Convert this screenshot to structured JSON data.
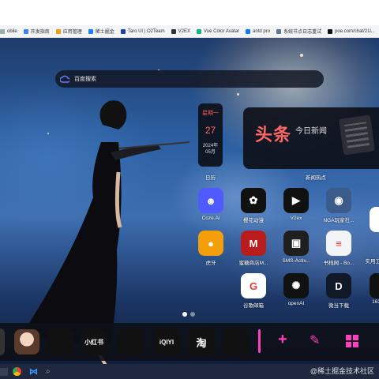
{
  "bookmarks": [
    {
      "label": "obile",
      "color": "#9aa"
    },
    {
      "label": "开发指南",
      "color": "#3b82f6"
    },
    {
      "label": "应用管理",
      "color": "#f59e0b"
    },
    {
      "label": "稀土掘金",
      "color": "#1e80ff"
    },
    {
      "label": "Taro UI | O2Team",
      "color": "#1e40af"
    },
    {
      "label": "V2EX",
      "color": "#333"
    },
    {
      "label": "Vue Color Avatar",
      "color": "#10b981"
    },
    {
      "label": "antd pro",
      "color": "#1677ff"
    },
    {
      "label": "系统节点日志重试",
      "color": "#64748b"
    },
    {
      "label": "poe.com/chat/21l...",
      "color": "#111"
    },
    {
      "label": "c",
      "color": "#888"
    }
  ],
  "search": {
    "placeholder": "百度搜索"
  },
  "calendar": {
    "weekday": "星期一",
    "day": "27",
    "year": "2024年",
    "month": "05月",
    "label": "日历"
  },
  "news": {
    "brand": "头条",
    "subtitle": "今日新闻",
    "label": "新闻热点"
  },
  "apps": [
    {
      "label": "Coze.Ai",
      "color": "#4f5bff",
      "glyph": "☻"
    },
    {
      "label": "樱花动漫",
      "color": "#111111",
      "glyph": "✿"
    },
    {
      "label": "V2ex",
      "color": "#111111",
      "glyph": "▶"
    },
    {
      "label": "NGA玩家社...",
      "color": "#3b5b8a",
      "glyph": "◉"
    },
    {
      "label": "虎牙",
      "color": "#f59e0b",
      "glyph": "●"
    },
    {
      "label": "蜜糖商店M...",
      "color": "#b91c1c",
      "glyph": "M"
    },
    {
      "label": "SMS-Activ...",
      "color": "#1f1f1f",
      "glyph": "▣"
    },
    {
      "label": "书栈网 - Bo...",
      "color": "#f3f4f6",
      "glyph": "≡"
    },
    {
      "label": "谷歌邮箱",
      "color": "#ffffff",
      "glyph": "G"
    },
    {
      "label": "openAI",
      "color": "#111111",
      "glyph": "✺"
    },
    {
      "label": "微当下载",
      "color": "#111827",
      "glyph": "D"
    }
  ],
  "right_partial": [
    {
      "label": "实用工"
    },
    {
      "label": "163"
    }
  ],
  "dock": [
    {
      "name": "tiktok",
      "label": "",
      "color": "#111"
    },
    {
      "name": "xiaohongshu",
      "label": "小红书",
      "color": "#111"
    },
    {
      "name": "shark",
      "label": "",
      "color": "#111"
    },
    {
      "name": "iqiyi",
      "label": "iQIYI",
      "color": "#111"
    },
    {
      "name": "taobao",
      "label": "淘",
      "color": "#111"
    },
    {
      "name": "box",
      "label": "",
      "color": "#111"
    }
  ],
  "watermark": "@稀土掘金技术社区"
}
